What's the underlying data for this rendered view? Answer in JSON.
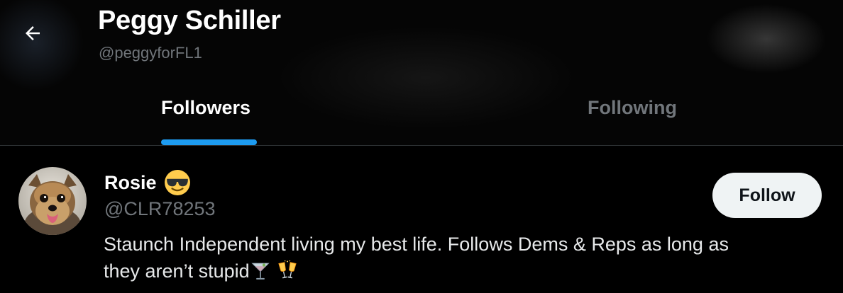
{
  "header": {
    "back_icon": "arrow-left-icon",
    "profile_name": "Peggy Schiller",
    "profile_handle": "@peggyforFL1"
  },
  "tabs": [
    {
      "label": "Followers",
      "active": true
    },
    {
      "label": "Following",
      "active": false
    }
  ],
  "colors": {
    "background": "#000000",
    "accent": "#1d9bf0",
    "muted_text": "#71767b",
    "primary_text": "#e7e9ea",
    "divider": "#2f3336",
    "follow_button_bg": "#eff3f4"
  },
  "users": [
    {
      "name": "Rosie",
      "name_emoji": "smiling-face-with-sunglasses-icon",
      "handle": "@CLR78253",
      "bio_line_1": "Staunch Independent living my best life. Follows Dems & Reps as long as",
      "bio_line_2": "they aren’t stupid",
      "bio_emojis": [
        "cocktail-glass-icon",
        "clinking-glasses-icon"
      ],
      "avatar": "avatar-yorkie-dog",
      "follow_label": "Follow"
    }
  ]
}
